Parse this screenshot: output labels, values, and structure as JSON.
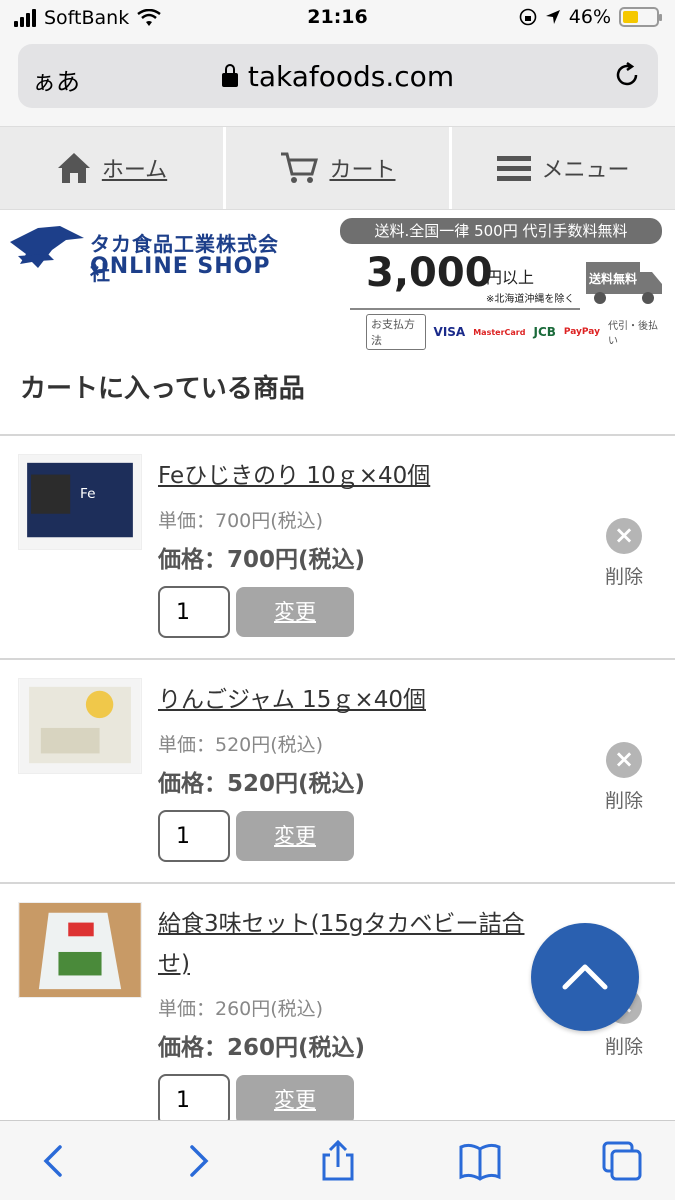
{
  "status": {
    "carrier": "SoftBank",
    "time": "21:16",
    "battery": "46%"
  },
  "browser": {
    "aa": "ぁあ",
    "url": "takafoods.com"
  },
  "nav": {
    "home": "ホーム",
    "cart": "カート",
    "menu": "メニュー"
  },
  "banner": {
    "company": "タカ食品工業株式会社",
    "shop": "ONLINE SHOP",
    "shipping_top": "送料.全国一律 500円 代引手数料無料",
    "threshold": "3,000",
    "threshold_suffix": "円以上",
    "note": "※北海道沖縄を除く",
    "free_label": "送料無料",
    "pay_label": "お支払方法",
    "pay_methods": [
      "VISA",
      "MasterCard",
      "JCB",
      "PayPay",
      "代引・後払い"
    ]
  },
  "cart": {
    "title": "カートに入っている商品",
    "change_label": "変更",
    "delete_label": "削除",
    "items": [
      {
        "name": "Feひじきのり 10ｇ×40個",
        "unit": "単価：700円(税込)",
        "price": "価格：700円(税込)",
        "qty": "1"
      },
      {
        "name": "りんごジャム 15ｇ×40個",
        "unit": "単価：520円(税込)",
        "price": "価格：520円(税込)",
        "qty": "1"
      },
      {
        "name": "給食3味セット(15gタカベビー詰合せ)",
        "unit": "単価：260円(税込)",
        "price": "価格：260円(税込)",
        "qty": "1"
      }
    ]
  }
}
